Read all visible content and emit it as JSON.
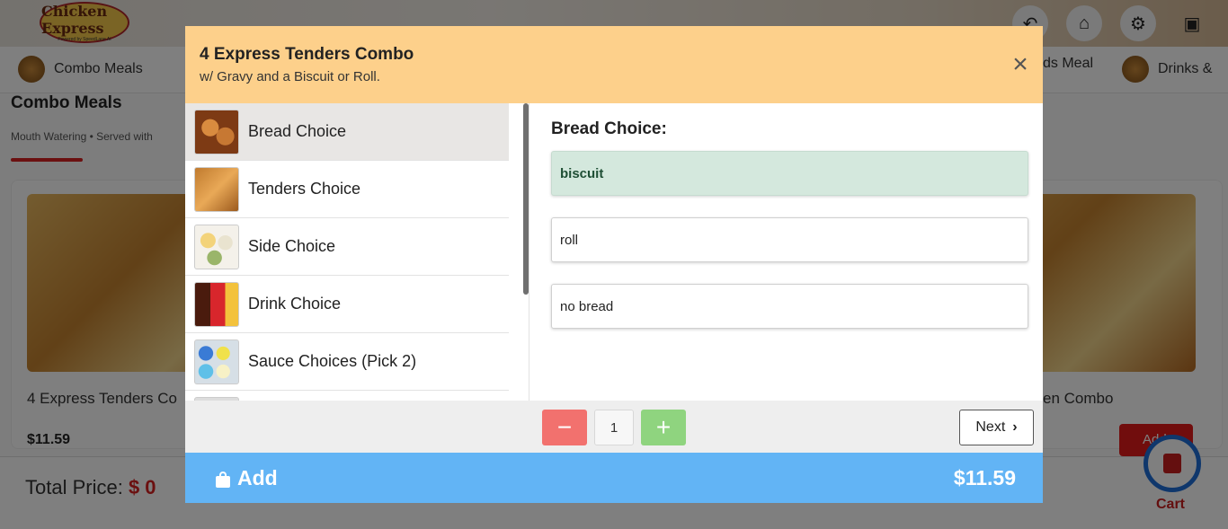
{
  "background": {
    "logo_text": "Chicken Express",
    "logo_sub": "Powered by SpeedLane AI",
    "nav": [
      "Combo Meals",
      "ds Meal",
      "Drinks &"
    ],
    "section_title": "Combo Meals",
    "section_sub": "Mouth Watering • Served with",
    "cards": [
      {
        "name": "4 Express Tenders Co",
        "price": "$11.59"
      },
      {
        "name": "en Combo",
        "add_label": "Add"
      }
    ],
    "total_label": "Total Price:",
    "total_value": "$ 0",
    "cart_label": "Cart"
  },
  "modal": {
    "title": "4 Express Tenders Combo",
    "subtitle": "w/ Gravy and a Biscuit or Roll.",
    "close_icon": "close-icon",
    "steps": [
      {
        "label": "Bread Choice",
        "active": true
      },
      {
        "label": "Tenders Choice",
        "active": false
      },
      {
        "label": "Side Choice",
        "active": false
      },
      {
        "label": "Drink Choice",
        "active": false
      },
      {
        "label": "Sauce Choices (Pick 2)",
        "active": false
      }
    ],
    "options_title": "Bread Choice:",
    "options": [
      {
        "label": "biscuit",
        "selected": true
      },
      {
        "label": "roll",
        "selected": false
      },
      {
        "label": "no bread",
        "selected": false
      }
    ],
    "quantity": {
      "minus": "−",
      "value": "1",
      "plus": "+"
    },
    "next_label": "Next",
    "add_label": "Add",
    "add_price": "$11.59",
    "colors": {
      "header": "#fdd08b",
      "selected_option": "#d4e8dd",
      "add_bar": "#62b4f5",
      "minus": "#f2716e",
      "plus": "#8fd47f"
    }
  }
}
